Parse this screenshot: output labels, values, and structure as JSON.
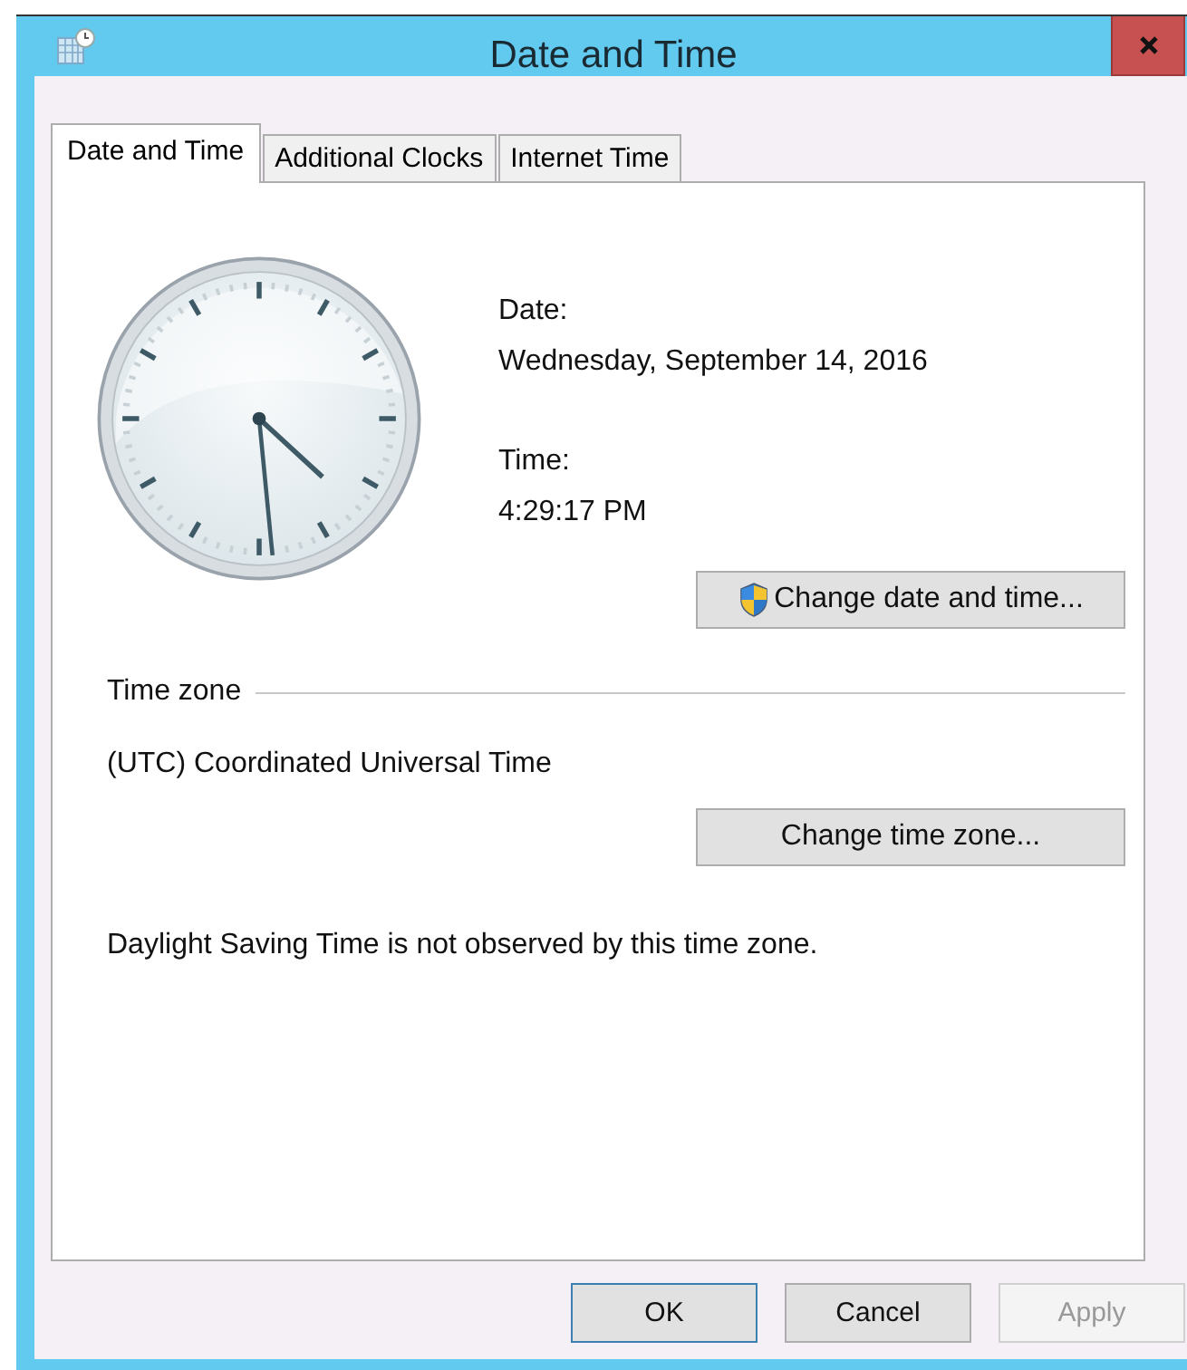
{
  "window": {
    "title": "Date and Time"
  },
  "tabs": [
    {
      "label": "Date and Time",
      "selected": true
    },
    {
      "label": "Additional Clocks",
      "selected": false
    },
    {
      "label": "Internet Time",
      "selected": false
    }
  ],
  "date": {
    "label": "Date:",
    "value": "Wednesday, September 14, 2016"
  },
  "time": {
    "label": "Time:",
    "value": "4:29:17 PM"
  },
  "change_date_button": {
    "label": "Change date and time..."
  },
  "time_zone": {
    "heading": "Time zone",
    "value": "(UTC) Coordinated Universal Time",
    "button": "Change time zone...",
    "note": "Daylight Saving Time is not observed by this time zone."
  },
  "buttons": [
    {
      "label": "OK",
      "default": true,
      "disabled": false
    },
    {
      "label": "Cancel",
      "default": false,
      "disabled": false
    },
    {
      "label": "Apply",
      "default": false,
      "disabled": true
    }
  ]
}
